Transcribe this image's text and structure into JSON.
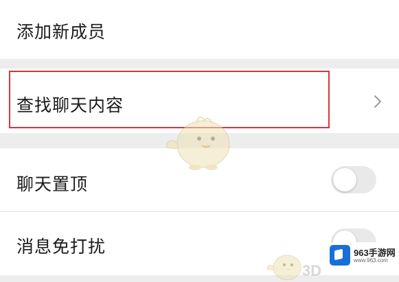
{
  "settings": {
    "items": [
      {
        "label": "添加新成员"
      },
      {
        "label": "查找聊天内容",
        "icon": "chevron-right-icon"
      },
      {
        "label": "聊天置顶",
        "toggle": "off"
      },
      {
        "label": "消息免打扰",
        "toggle": "off"
      }
    ]
  },
  "highlight": {
    "color": "#d8333a"
  },
  "watermark": {
    "mascot_icon": "cartoon-bird-icon",
    "text_3d": "3D",
    "logo_name": "963手游网",
    "logo_url": "www.963.com"
  }
}
